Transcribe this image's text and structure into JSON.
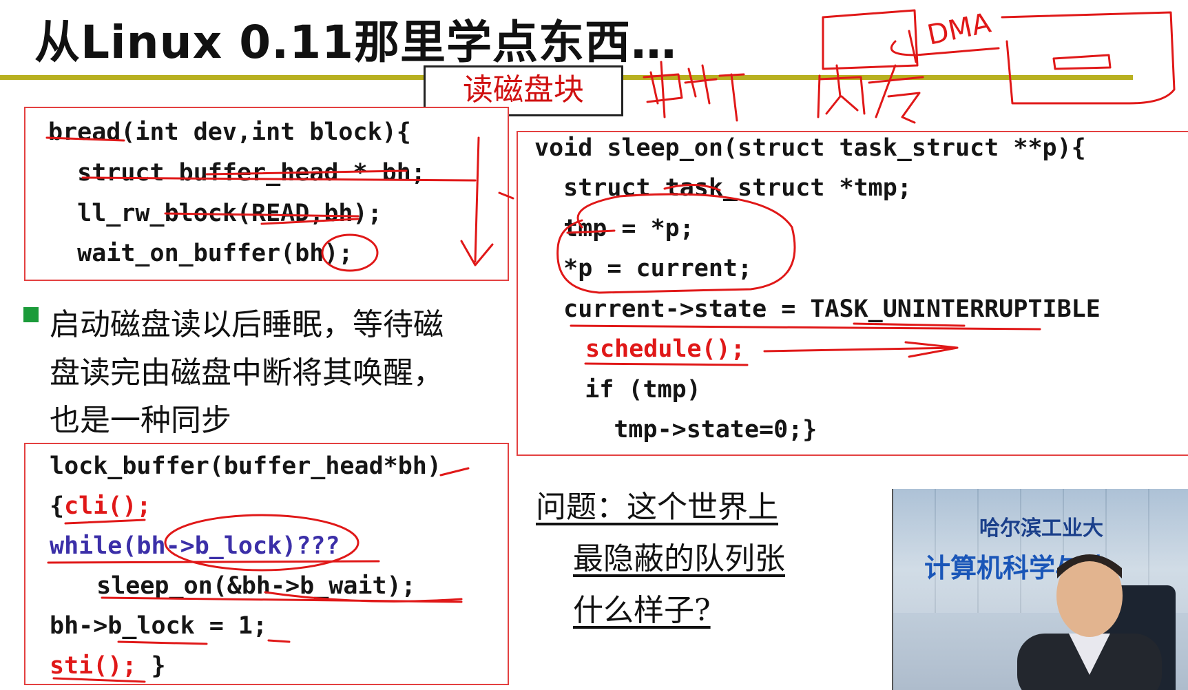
{
  "slide": {
    "title": "从Linux 0.11那里学点东西…",
    "section_tag": "读磁盘块"
  },
  "code_bread": [
    "bread(int dev,int block){",
    "  struct buffer_head * bh;",
    "  ll_rw_block(READ,bh);",
    "  wait_on_buffer(bh);"
  ],
  "bullet": {
    "lines": [
      "启动磁盘读以后睡眠，等待磁",
      "盘读完由磁盘中断将其唤醒，",
      "也是一种同步"
    ]
  },
  "code_lock": {
    "line1": "lock_buffer(buffer_head*bh)",
    "line2_brace": "{",
    "line2_cli": "cli();",
    "line3_while": "while",
    "line3_rest": "(bh->b_lock)???",
    "line4": "  sleep_on(&bh->b_wait);",
    "line5": "bh->b_lock = 1;",
    "line6_sti": "sti();",
    "line6_rest": " }"
  },
  "code_sleep": {
    "line1": "void sleep_on(struct task_struct **p){",
    "line2": "  struct task_struct *tmp;",
    "line3": "  tmp = *p;",
    "line4": "  *p = current;",
    "line5": "  current->state = TASK_UNINTERRUPTIBLE",
    "line6_sched": "schedule();",
    "line7": "   if (tmp)",
    "line8": "     tmp->state=0;}"
  },
  "question": {
    "line1": "问题：这个世界上",
    "line2": "最隐蔽的队列张",
    "line3": "什么样子?"
  },
  "video": {
    "school": "哈尔滨工业大",
    "college": "计算机科学与技"
  },
  "handwriting": {
    "interrupt": "中断",
    "memory": "内存",
    "dma": "DMA"
  },
  "colors": {
    "accent_bar": "#b8b020",
    "code_red": "#e01818",
    "box_border": "#e34040",
    "bullet_green": "#1b9b3a",
    "keyword_blue": "#3b2fa8"
  }
}
